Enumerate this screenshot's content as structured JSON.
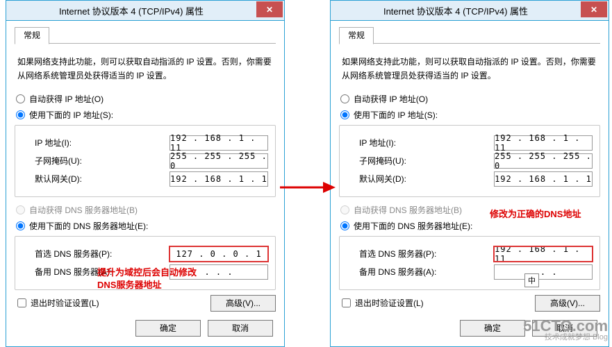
{
  "window_title": "Internet 协议版本 4 (TCP/IPv4) 属性",
  "close_glyph": "✕",
  "tab_label": "常规",
  "description": "如果网络支持此功能，则可以获取自动指派的 IP 设置。否则，你需要从网络系统管理员处获得适当的 IP 设置。",
  "ip_radio_auto": "自动获得 IP 地址(O)",
  "ip_radio_manual": "使用下面的 IP 地址(S):",
  "ip_label": "IP 地址(I):",
  "mask_label": "子网掩码(U):",
  "gateway_label": "默认网关(D):",
  "dns_radio_auto": "自动获得 DNS 服务器地址(B)",
  "dns_radio_manual": "使用下面的 DNS 服务器地址(E):",
  "dns_primary_label": "首选 DNS 服务器(P):",
  "dns_alt_label": "备用 DNS 服务器(A):",
  "validate_label": "退出时验证设置(L)",
  "advanced_btn": "高级(V)...",
  "ok_btn": "确定",
  "cancel_btn": "取消",
  "left": {
    "ip": "192 . 168 .  1  . 11",
    "mask": "255 . 255 . 255 .  0",
    "gateway": "192 . 168 .  1  .  1",
    "dns_primary": "127 .  0  .  0  .  1",
    "dns_alt": " .       .       . ",
    "annotation": "提升为域控后会自动修改\nDNS服务器地址"
  },
  "right": {
    "ip": "192 . 168 .  1  . 11",
    "mask": "255 . 255 . 255 .  0",
    "gateway": "192 . 168 .  1  .  1",
    "dns_primary": "192 . 168 .  1  . 11",
    "dns_alt": " .       .       . ",
    "annotation": "修改为正确的DNS地址",
    "ime": "中"
  },
  "watermark": {
    "big": "51CTO.com",
    "small": "技术成就梦想 Blog"
  }
}
